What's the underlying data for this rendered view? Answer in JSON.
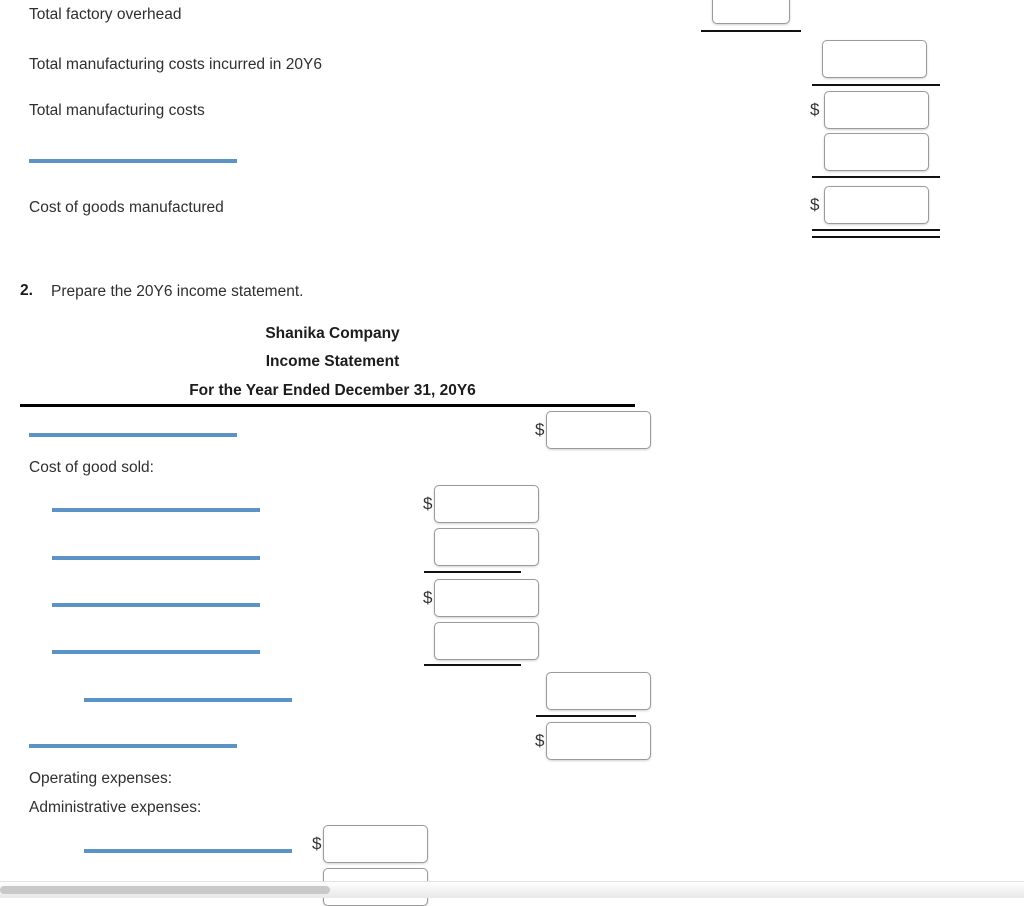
{
  "part1": {
    "rows": [
      {
        "label": "Total factory overhead"
      },
      {
        "label": "Total manufacturing costs incurred in 20Y6"
      },
      {
        "label": "Total manufacturing costs"
      },
      {
        "label": "Cost of goods manufactured"
      }
    ],
    "currency_symbol": "$"
  },
  "question2": {
    "number": "2.",
    "text": "Prepare the 20Y6 income statement."
  },
  "statement_header": {
    "company": "Shanika Company",
    "title": "Income Statement",
    "period": "For the Year Ended December 31, 20Y6"
  },
  "statement_body": {
    "cost_of_goods_sold_label": "Cost of good sold:",
    "operating_expenses_label": "Operating expenses:",
    "administrative_expenses_label": "Administrative expenses:"
  },
  "currency_symbol": "$",
  "input_values": {
    "top_partial": "",
    "total_mfg_incurred": "",
    "total_mfg_costs": "",
    "less_ending_wip": "",
    "cost_of_goods_manufactured": "",
    "sales": "",
    "cogs_a": "",
    "cogs_b": "",
    "cogs_c": "",
    "cogs_d": "",
    "cogs_subtotal": "",
    "gross_profit": "",
    "admin_a": "",
    "admin_b": ""
  },
  "colors": {
    "answer_rule": "#5b93c7",
    "total_rule": "#111111",
    "header_rule": "#000000",
    "text": "#2f2f2f"
  }
}
